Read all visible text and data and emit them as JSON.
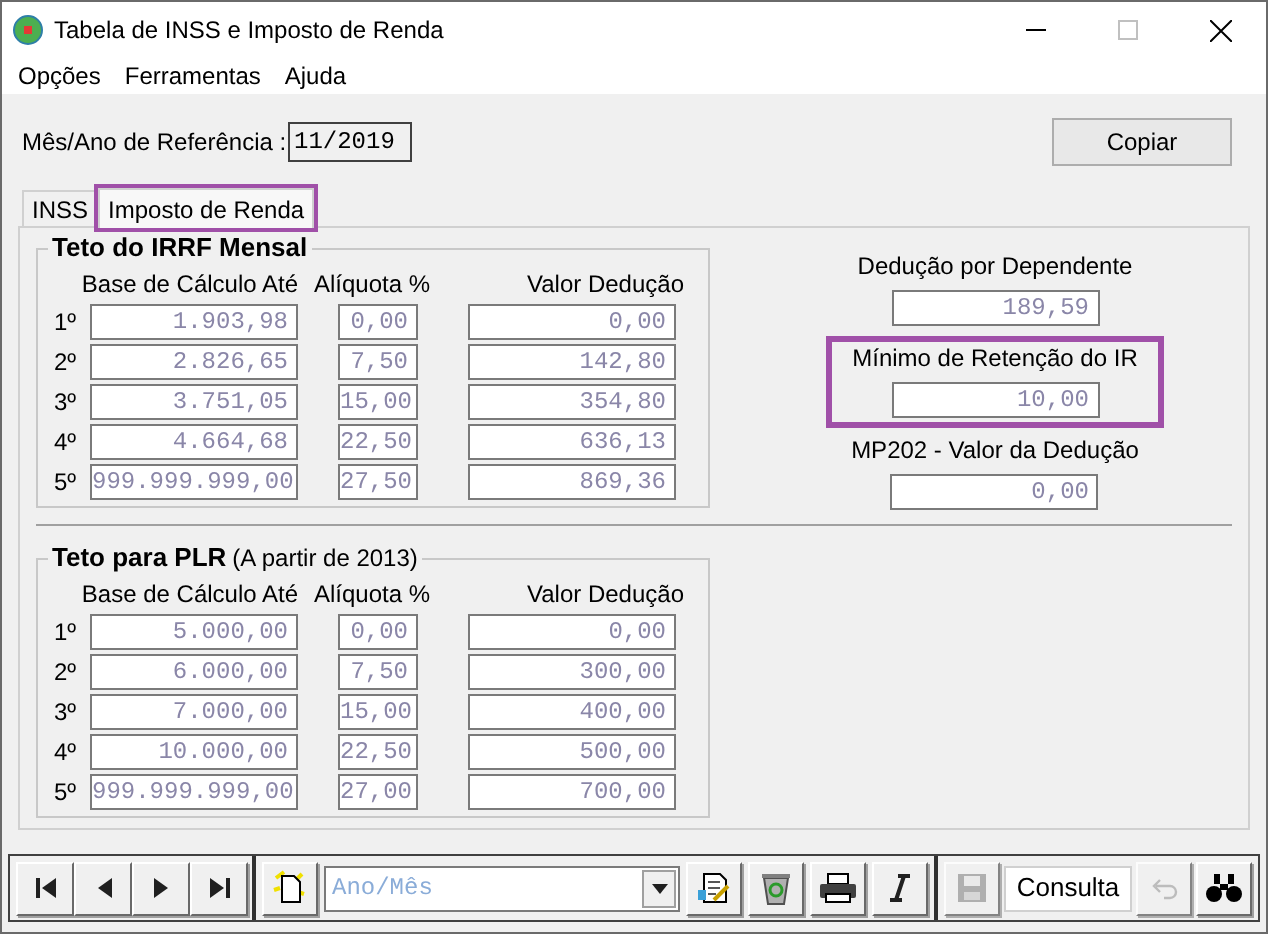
{
  "window": {
    "title": "Tabela de INSS e Imposto de Renda"
  },
  "menu": [
    "Opções",
    "Ferramentas",
    "Ajuda"
  ],
  "reference": {
    "label": "Mês/Ano de Referência :",
    "value": "11/2019"
  },
  "copy_button": "Copiar",
  "tabs": [
    {
      "label": "INSS",
      "selected": false,
      "highlighted": false
    },
    {
      "label": "Imposto de Renda",
      "selected": true,
      "highlighted": true
    }
  ],
  "irrf_group": {
    "title": "Teto do IRRF Mensal",
    "columns": [
      "Base de Cálculo Até",
      "Alíquota %",
      "Valor Dedução"
    ],
    "rows": [
      {
        "rank": "1º",
        "base": "1.903,98",
        "rate": "0,00",
        "deduction": "0,00"
      },
      {
        "rank": "2º",
        "base": "2.826,65",
        "rate": "7,50",
        "deduction": "142,80"
      },
      {
        "rank": "3º",
        "base": "3.751,05",
        "rate": "15,00",
        "deduction": "354,80"
      },
      {
        "rank": "4º",
        "base": "4.664,68",
        "rate": "22,50",
        "deduction": "636,13"
      },
      {
        "rank": "5º",
        "base": "999.999.999,00",
        "rate": "27,50",
        "deduction": "869,36"
      }
    ]
  },
  "right_fields": [
    {
      "label": "Dedução por Dependente",
      "value": "189,59",
      "highlighted": false
    },
    {
      "label": "Mínimo de Retenção do IR",
      "value": "10,00",
      "highlighted": true
    },
    {
      "label": "MP202 - Valor da Dedução",
      "value": "0,00",
      "highlighted": false
    }
  ],
  "plr_group": {
    "title": "Teto para PLR",
    "subtitle": "(A partir de 2013)",
    "columns": [
      "Base de Cálculo Até",
      "Alíquota %",
      "Valor Dedução"
    ],
    "rows": [
      {
        "rank": "1º",
        "base": "5.000,00",
        "rate": "0,00",
        "deduction": "0,00"
      },
      {
        "rank": "2º",
        "base": "6.000,00",
        "rate": "7,50",
        "deduction": "300,00"
      },
      {
        "rank": "3º",
        "base": "7.000,00",
        "rate": "15,00",
        "deduction": "400,00"
      },
      {
        "rank": "4º",
        "base": "10.000,00",
        "rate": "22,50",
        "deduction": "500,00"
      },
      {
        "rank": "5º",
        "base": "999.999.999,00",
        "rate": "27,00",
        "deduction": "700,00"
      }
    ]
  },
  "toolbar": [
    {
      "kind": "first",
      "disabled": false
    },
    {
      "kind": "prev",
      "disabled": false
    },
    {
      "kind": "next",
      "disabled": false
    },
    {
      "kind": "last",
      "disabled": false
    },
    {
      "kind": "new",
      "disabled": false
    },
    {
      "kind": "combo",
      "placeholder": "Ano/Mês"
    },
    {
      "kind": "edit",
      "disabled": false
    },
    {
      "kind": "delete",
      "disabled": false
    },
    {
      "kind": "print",
      "disabled": false
    },
    {
      "kind": "italic",
      "disabled": false
    },
    {
      "kind": "save",
      "disabled": true
    },
    {
      "kind": "status",
      "text": "Consulta"
    },
    {
      "kind": "undo",
      "disabled": true
    },
    {
      "kind": "find",
      "disabled": false
    }
  ]
}
